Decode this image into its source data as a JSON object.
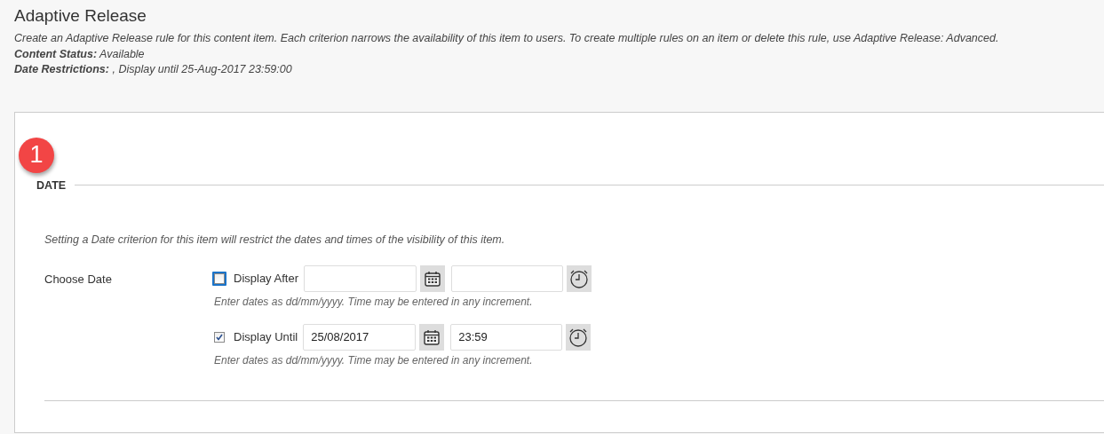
{
  "page": {
    "title": "Adaptive Release",
    "description": "Create an Adaptive Release rule for this content item. Each criterion narrows the availability of this item to users. To create multiple rules on an item or delete this rule, use Adaptive Release: Advanced.",
    "details": [
      {
        "label": "Content Status:",
        "value": " Available"
      },
      {
        "label": "Date Restrictions:",
        "value": " , Display until 25-Aug-2017 23:59:00"
      }
    ]
  },
  "step_badge": "1",
  "section": {
    "heading": "DATE",
    "instructions": "Setting a Date criterion for this item will restrict the dates and times of the visibility of this item.",
    "field_label": "Choose Date",
    "rows": [
      {
        "label": "Display After",
        "checked": false,
        "focused": true,
        "date": "",
        "time": "",
        "hint": "Enter dates as dd/mm/yyyy. Time may be entered in any increment."
      },
      {
        "label": "Display Until",
        "checked": true,
        "focused": false,
        "date": "25/08/2017",
        "time": "23:59",
        "hint": "Enter dates as dd/mm/yyyy. Time may be entered in any increment."
      }
    ]
  }
}
